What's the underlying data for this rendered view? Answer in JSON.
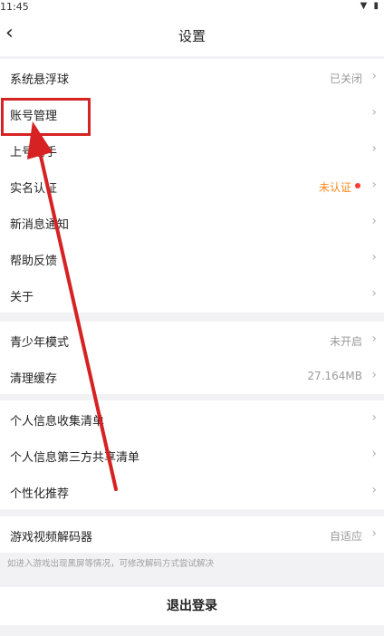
{
  "status": {
    "time": "11:45",
    "icons": "▼ ▮"
  },
  "nav": {
    "back": "‹",
    "title": "设置"
  },
  "groups": [
    [
      {
        "label": "系统悬浮球",
        "value": "已关闭"
      },
      {
        "label": "账号管理",
        "value": ""
      },
      {
        "label": "上号助手",
        "value": ""
      },
      {
        "label": "实名认证",
        "value": "未认证",
        "dot": true
      },
      {
        "label": "新消息通知",
        "value": ""
      },
      {
        "label": "帮助反馈",
        "value": ""
      },
      {
        "label": "关于",
        "value": ""
      }
    ],
    [
      {
        "label": "青少年模式",
        "value": "未开启"
      },
      {
        "label": "清理缓存",
        "value": "27.164MB"
      }
    ],
    [
      {
        "label": "个人信息收集清单",
        "value": ""
      },
      {
        "label": "个人信息第三方共享清单",
        "value": ""
      },
      {
        "label": "个性化推荐",
        "value": ""
      }
    ],
    [
      {
        "label": "游戏视频解码器",
        "value": "自适应"
      }
    ]
  ],
  "chevron": "›",
  "hint": "如进入游戏出现黑屏等情况，可修改解码方式尝试解决",
  "logout": "退出登录",
  "colors": {
    "annotation": "#d62222",
    "warning": "#ff8a1f",
    "dot": "#ff3b30"
  }
}
